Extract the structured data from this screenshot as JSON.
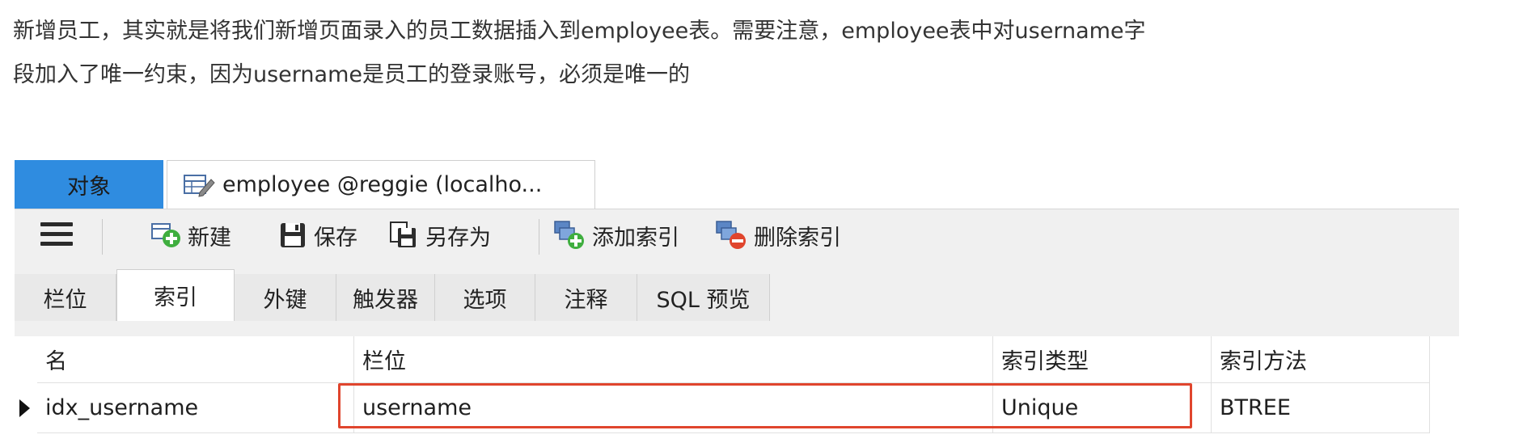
{
  "intro": {
    "line1": "新增员工，其实就是将我们新增页面录入的员工数据插入到employee表。需要注意，employee表中对username字",
    "line2": "段加入了唯一约束，因为username是员工的登录账号，必须是唯一的"
  },
  "tabs": {
    "objects": "对象",
    "employee": "employee @reggie (localho..."
  },
  "toolbar": {
    "new": "新建",
    "save": "保存",
    "save_as": "另存为",
    "add_index": "添加索引",
    "delete_index": "删除索引"
  },
  "subtabs": [
    "栏位",
    "索引",
    "外键",
    "触发器",
    "选项",
    "注释",
    "SQL 预览"
  ],
  "active_subtab": "索引",
  "grid": {
    "headers": {
      "name": "名",
      "column": "栏位",
      "index_type": "索引类型",
      "index_method": "索引方法"
    },
    "rows": [
      {
        "name": "idx_username",
        "column": "username",
        "index_type": "Unique",
        "index_method": "BTREE"
      }
    ]
  },
  "colors": {
    "objects_tab": "#2f8ce0",
    "highlight": "#e0452d",
    "toolbar_bg": "#f0f0f0"
  }
}
